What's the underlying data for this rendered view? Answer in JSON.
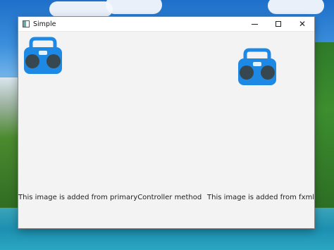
{
  "window": {
    "title": "Simple",
    "controls": {
      "minimize_icon": "minimize-icon",
      "maximize_icon": "maximize-icon",
      "close_icon": "close-icon"
    }
  },
  "content": {
    "left_image": {
      "icon": "boombox-icon",
      "caption": "This image is added from primaryController method"
    },
    "right_image": {
      "icon": "boombox-icon",
      "caption": "This image is added from fxml"
    }
  },
  "colors": {
    "boombox_blue": "#1e88e5",
    "boombox_dark": "#37474f",
    "window_bg": "#f3f3f3"
  }
}
